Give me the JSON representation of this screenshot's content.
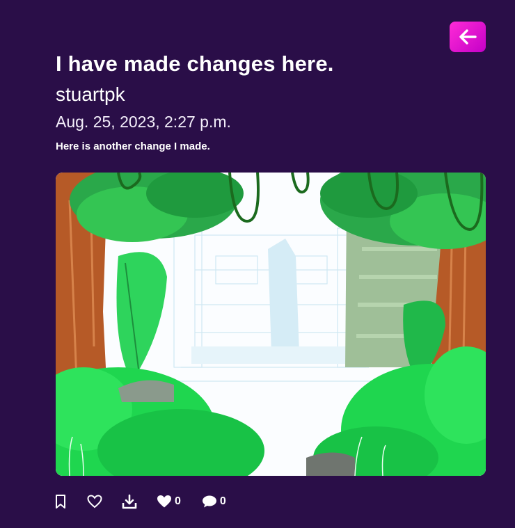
{
  "post": {
    "title": "I have made changes here.",
    "author": "stuartpk",
    "date": "Aug. 25, 2023, 2:27 p.m.",
    "description": "Here is another change I made."
  },
  "icons": {
    "back": "arrow-left-icon",
    "bookmark": "bookmark-icon",
    "like": "heart-outline-icon",
    "download": "download-icon",
    "likes": "heart-filled-icon",
    "comments": "comment-icon"
  },
  "stats": {
    "likes": "0",
    "comments": "0"
  },
  "colors": {
    "background": "#2a0e48",
    "accent": "#e20ad8",
    "text": "#ffffff"
  }
}
